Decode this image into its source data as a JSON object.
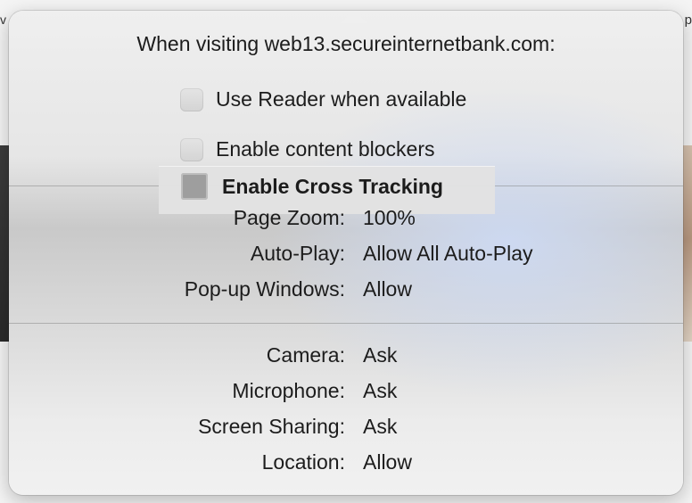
{
  "background": {
    "left_fragment": "v",
    "right_fragment": "p"
  },
  "popover": {
    "title": "When visiting web13.secureinternetbank.com:",
    "checkboxes": [
      {
        "label": "Use Reader when available",
        "checked": false
      },
      {
        "label": "Enable content blockers",
        "checked": false
      },
      {
        "label": "Enable Cross Tracking",
        "checked": false
      }
    ],
    "settings": [
      {
        "label": "Page Zoom:",
        "value": "100%"
      },
      {
        "label": "Auto-Play:",
        "value": "Allow All Auto-Play"
      },
      {
        "label": "Pop-up Windows:",
        "value": "Allow"
      }
    ],
    "permissions": [
      {
        "label": "Camera:",
        "value": "Ask"
      },
      {
        "label": "Microphone:",
        "value": "Ask"
      },
      {
        "label": "Screen Sharing:",
        "value": "Ask"
      },
      {
        "label": "Location:",
        "value": "Allow"
      }
    ]
  }
}
